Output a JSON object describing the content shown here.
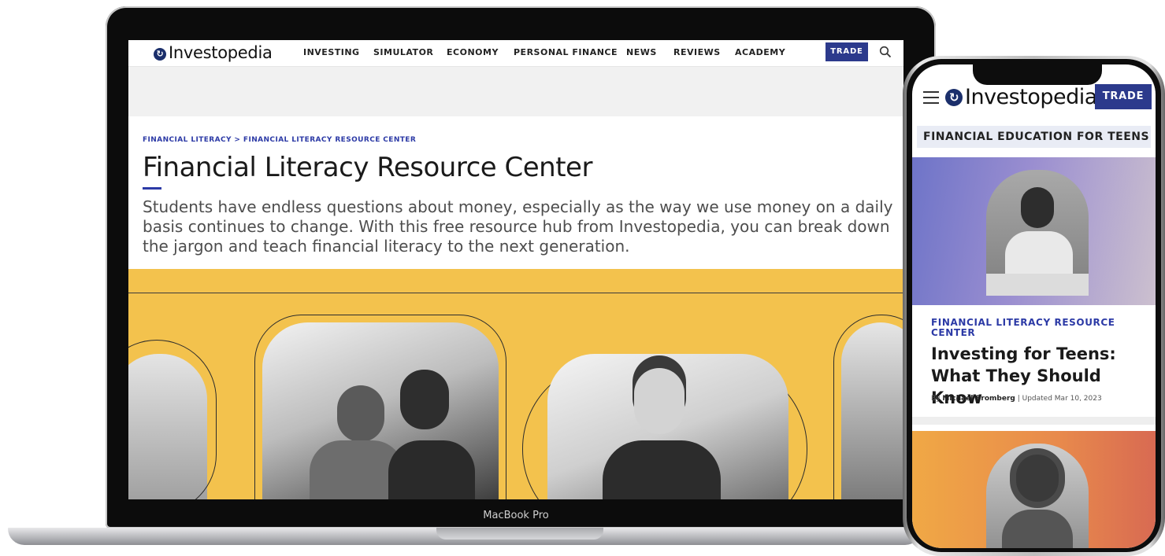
{
  "laptop": {
    "bezel_label": "MacBook Pro",
    "nav": {
      "logo": "Investopedia",
      "links": [
        "INVESTING",
        "SIMULATOR",
        "ECONOMY",
        "PERSONAL FINANCE",
        "NEWS",
        "REVIEWS",
        "ACADEMY"
      ],
      "trade_label": "TRADE",
      "search_icon": "search-icon"
    },
    "breadcrumb": "FINANCIAL LITERACY > FINANCIAL LITERACY RESOURCE CENTER",
    "title": "Financial Literacy Resource Center",
    "intro": "Students have endless questions about money, especially as the way we use money on a daily basis continues to change. With this free resource hub from Investopedia, you can break down the jargon and teach financial literacy to the next generation.",
    "hero_color": "#f3c24d"
  },
  "phone": {
    "menu_icon": "hamburger-menu-icon",
    "logo": "Investopedia",
    "trade_label": "TRADE",
    "section_label": "FINANCIAL EDUCATION FOR TEENS",
    "article": {
      "kicker": "FINANCIAL LITERACY RESOURCE CENTER",
      "headline": "Investing for Teens: What They Should Know",
      "byline_prefix": "By",
      "author": "Michael Bromberg",
      "updated": "| Updated Mar 10, 2023"
    }
  },
  "colors": {
    "brand_blue": "#2c3a8c",
    "link_blue": "#2c3aa6"
  }
}
